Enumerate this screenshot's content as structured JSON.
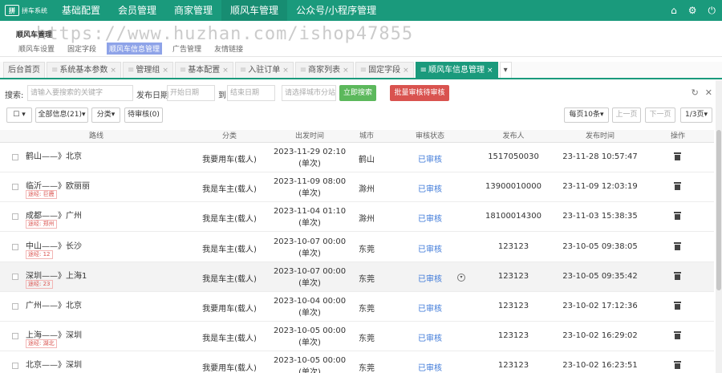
{
  "app": {
    "logo_text": "拼车系统",
    "logo_mark": "拼"
  },
  "nav": [
    "基础配置",
    "会员管理",
    "商家管理",
    "顺风车管理",
    "公众号/小程序管理"
  ],
  "subheader": {
    "title": "顺风车管理",
    "tabs": [
      "顺风车设置",
      "固定字段",
      "顺风车信息管理",
      "广告管理",
      "友情链接"
    ],
    "active_tab": 2
  },
  "watermark": "https://www.huzhan.com/ishop47855",
  "page_tabs": [
    "后台首页",
    "系统基本参数",
    "管理组",
    "基本配置",
    "入驻订单",
    "商家列表",
    "固定字段",
    "顺风车信息管理"
  ],
  "search": {
    "label": "搜索:",
    "keyword_placeholder": "请输入要搜索的关键字",
    "date_label": "发布日期",
    "start_placeholder": "开始日期",
    "to_label": "到",
    "end_placeholder": "结束日期",
    "city_placeholder": "请选择城市分站",
    "search_button": "立即搜索",
    "batch_button": "批量审核待审核"
  },
  "actions": {
    "all_info": "全部信息(21)",
    "category": "分类",
    "pending": "待审核(0)",
    "per_page": "每页10条",
    "prev": "上一页",
    "next": "下一页",
    "page": "1/3页"
  },
  "columns": [
    "路线",
    "分类",
    "出发时间",
    "城市",
    "审核状态",
    "发布人",
    "发布时间",
    "操作"
  ],
  "rows": [
    {
      "route": "鹤山——》北京",
      "via": "",
      "type": "我要用车(载人)",
      "time1": "2023-11-29 02:10",
      "time2": "(单次)",
      "city": "鹤山",
      "audit": "已审核",
      "publisher": "1517050030",
      "pubtime": "23-11-28 10:57:47",
      "highlight": false
    },
    {
      "route": "临沂——》欧丽丽",
      "via": "途经: 巨鹿",
      "type": "我是车主(载人)",
      "time1": "2023-11-09 08:00",
      "time2": "(单次)",
      "city": "滁州",
      "audit": "已审核",
      "publisher": "13900010000",
      "pubtime": "23-11-09 12:03:19",
      "highlight": false
    },
    {
      "route": "成都——》广州",
      "via": "途经: 郑州",
      "type": "我是车主(载人)",
      "time1": "2023-11-04 01:10",
      "time2": "(单次)",
      "city": "滁州",
      "audit": "已审核",
      "publisher": "18100014300",
      "pubtime": "23-11-03 15:38:35",
      "highlight": false
    },
    {
      "route": "中山——》长沙",
      "via": "途经: 12",
      "type": "我是车主(载人)",
      "time1": "2023-10-07 00:00",
      "time2": "(单次)",
      "city": "东莞",
      "audit": "已审核",
      "publisher": "123123",
      "pubtime": "23-10-05 09:38:05",
      "highlight": false
    },
    {
      "route": "深圳——》上海1",
      "via": "途经: 23",
      "type": "我是车主(载人)",
      "time1": "2023-10-07 00:00",
      "time2": "(单次)",
      "city": "东莞",
      "audit": "已审核",
      "publisher": "123123",
      "pubtime": "23-10-05 09:35:42",
      "highlight": true
    },
    {
      "route": "广州——》北京",
      "via": "",
      "type": "我要用车(载人)",
      "time1": "2023-10-04 00:00",
      "time2": "(单次)",
      "city": "东莞",
      "audit": "已审核",
      "publisher": "123123",
      "pubtime": "23-10-02 17:12:36",
      "highlight": false
    },
    {
      "route": "上海——》深圳",
      "via": "途经: 湖北",
      "type": "我是车主(载人)",
      "time1": "2023-10-05 00:00",
      "time2": "(单次)",
      "city": "东莞",
      "audit": "已审核",
      "publisher": "123123",
      "pubtime": "23-10-02 16:29:02",
      "highlight": false
    },
    {
      "route": "北京——》深圳",
      "via": "",
      "type": "我要用车(载人)",
      "time1": "2023-10-05 00:00",
      "time2": "(单次)",
      "city": "东莞",
      "audit": "已审核",
      "publisher": "123123",
      "pubtime": "23-10-02 16:23:51",
      "highlight": false
    }
  ],
  "colors": {
    "primary": "#1a9a7c",
    "success": "#5cb85c",
    "danger": "#d9534f",
    "link": "#3c78d8"
  }
}
